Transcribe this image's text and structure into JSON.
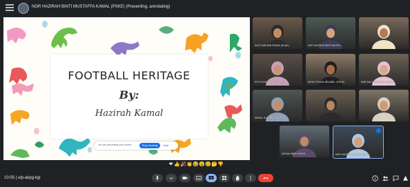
{
  "presenter": {
    "title": "NOR HAZIRAH BINTI MUSTAFFA KAMAL (PSKE) (Presenting, annotating)"
  },
  "slide": {
    "title": "FOOTBALL HERITAGE",
    "by": "By:",
    "author": "Hazirah Kamal",
    "share_text": "You are presenting your screen",
    "stop_label": "Stop sharing",
    "hide_label": "Hide"
  },
  "participants": [
    {
      "name": "SALTI BIN ABD RAZAK (SUAK)"
    },
    {
      "name": "NOR HAZIRAH BINTI MUSTA..."
    },
    {
      "name": "..."
    },
    {
      "name": "SITI SYUHADA BINTI ABD..."
    },
    {
      "name": "MOHD FOIZAL BIN ABD...(PSKE)"
    },
    {
      "name": "NUR AIN SOFIA BINTI MUSTA..."
    },
    {
      "name": "NURUL SYAZWANI BINTI..."
    },
    {
      "name": "..."
    },
    {
      "name": "..."
    },
    {
      "name": "SAFIAH BINTI MOHD..."
    },
    {
      "name": "NOR HAZIRAH BINTI MUSTA..."
    }
  ],
  "reactions": [
    "❤",
    "👍",
    "🎉",
    "👏",
    "😂",
    "😮",
    "😢",
    "🤔",
    "👎"
  ],
  "toolbar": {
    "clock": "10:05 | ulp-akpg-kgi"
  },
  "colors": {
    "leave": "#ea4335",
    "accent": "#8ab4f8",
    "toolbar_bg": "#202124",
    "button_bg": "#3c4043"
  }
}
